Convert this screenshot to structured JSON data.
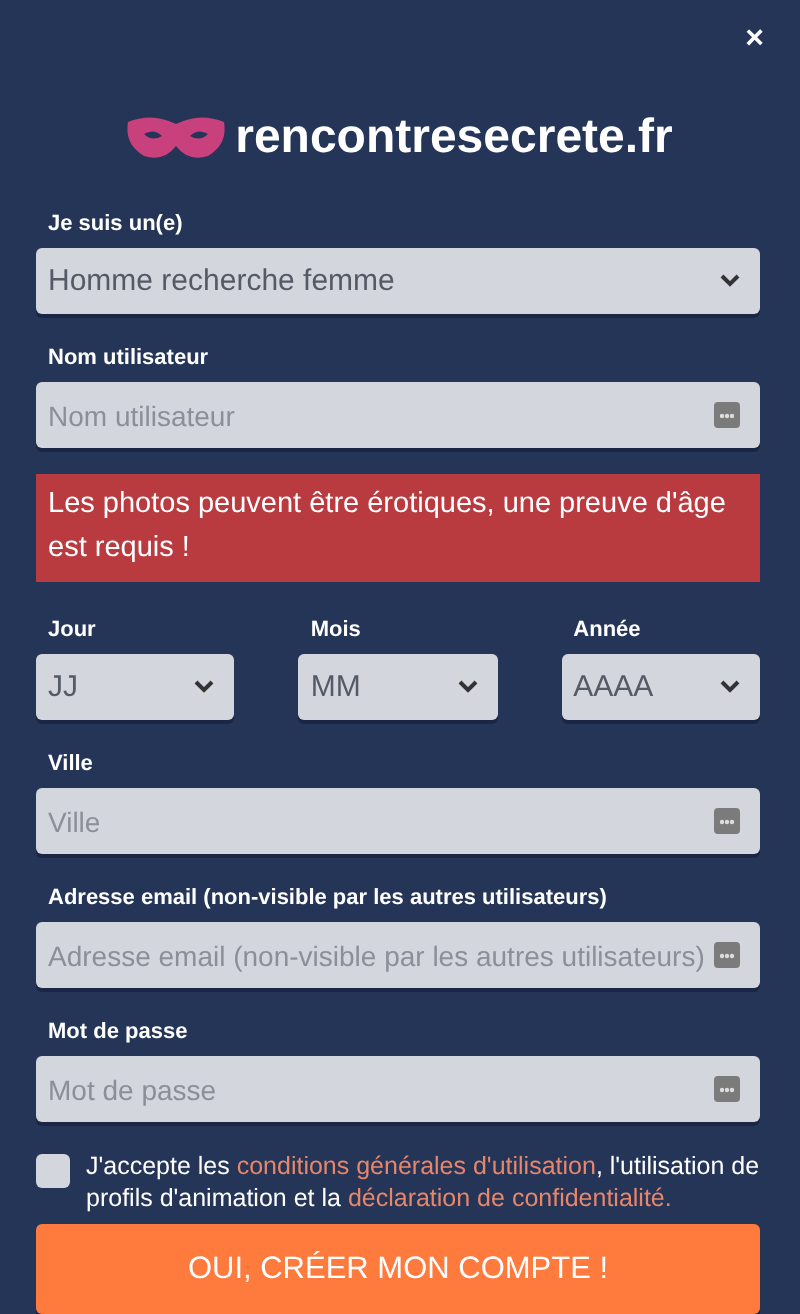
{
  "close": "×",
  "logo": {
    "text": "rencontresecrete.fr"
  },
  "form": [
    {
      "kind": "select",
      "label": "Je suis un(e)",
      "value": "Homme recherche femme"
    },
    {
      "kind": "input",
      "label": "Nom utilisateur",
      "placeholder": "Nom utilisateur"
    },
    {
      "kind": "alert",
      "text": "Les photos peuvent être érotiques, une preuve d'âge est requis !"
    },
    {
      "kind": "date_row",
      "selects": [
        {
          "label": "Jour",
          "value": "JJ"
        },
        {
          "label": "Mois",
          "value": "MM"
        },
        {
          "label": "Année",
          "value": "AAAA"
        }
      ]
    },
    {
      "kind": "input",
      "label": "Ville",
      "placeholder": "Ville"
    },
    {
      "kind": "input",
      "label": "Adresse email (non-visible par les autres utilisateurs)",
      "placeholder": "Adresse email (non-visible par les autres utilisateurs)"
    },
    {
      "kind": "input",
      "label": "Mot de passe",
      "placeholder": "Mot de passe"
    }
  ],
  "consent": {
    "checked": false,
    "parts": [
      {
        "kind": "text",
        "text": "J'accepte les "
      },
      {
        "kind": "link",
        "text": "conditions générales d'utilisation"
      },
      {
        "kind": "text",
        "text": ", l'utilisation de profils d'animation et la "
      },
      {
        "kind": "link",
        "text": "déclaration de confidentialité."
      }
    ]
  },
  "submit": "OUI, CRÉER MON COMPTE !"
}
